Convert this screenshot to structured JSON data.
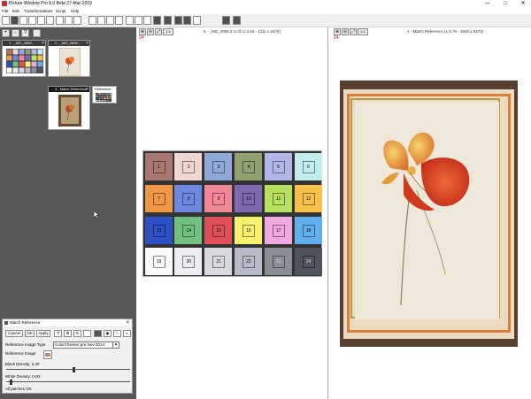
{
  "window": {
    "title": "Picture Window Pro 8.0 Beta 27-Mar-2019",
    "controls": [
      "—",
      "□",
      "✕"
    ]
  },
  "menu": [
    "File",
    "Edit",
    "Transformations",
    "Script",
    "Help"
  ],
  "left_pane": {
    "thumbnails": [
      {
        "label": "1 - _MG_4908...",
        "kind": "colorchecker"
      },
      {
        "label": "2 - _MG_4908...",
        "kind": "flower"
      },
      {
        "label": "3 - Match Reference",
        "kind": "flower-brown"
      }
    ],
    "reference_tag": "Reference"
  },
  "panel": {
    "title": "Match Reference",
    "buttons": {
      "cancel": "Cancel",
      "ok": "OK",
      "apply": "Apply"
    },
    "help": "?",
    "reference_image_type_label": "Reference Image Type",
    "reference_image_type_value": "ColorChecker pre Nov-2014",
    "reference_image_label": "Reference Image",
    "black_density_label": "Black Density: 2.30",
    "black_density_value": 0.55,
    "white_density_label": "White Density: 0.00",
    "white_density_value": 0.03,
    "status": "All patches OK"
  },
  "views": {
    "left": {
      "header": "5 - _MG_4908 8 cr.tif (1:3.93 - 2111 x 1679)",
      "zoom_badge": "24"
    },
    "right": {
      "header": "4 - Match Reference (1:9.79 - 3648 x 5472)",
      "zoom_badge": "24"
    },
    "zoom_tools": [
      "⊕",
      "⊖",
      "⤢",
      "1:1"
    ]
  },
  "colors": {
    "left_pane_bg": "#575757",
    "accent_red": "#d00000",
    "frame_orange": "#d8803a"
  },
  "colorchecker": [
    {
      "label": "1",
      "color": "#a87870"
    },
    {
      "label": "2",
      "color": "#f0d8d0"
    },
    {
      "label": "3",
      "color": "#8ea8d8"
    },
    {
      "label": "4",
      "color": "#90a070"
    },
    {
      "label": "5",
      "color": "#b0b8e8"
    },
    {
      "label": "6",
      "color": "#c0ecec"
    },
    {
      "label": "7",
      "color": "#f09848"
    },
    {
      "label": "8",
      "color": "#6c88e0"
    },
    {
      "label": "9",
      "color": "#f08898"
    },
    {
      "label": "10",
      "color": "#8068b0"
    },
    {
      "label": "11",
      "color": "#b8e060"
    },
    {
      "label": "12",
      "color": "#f8c048"
    },
    {
      "label": "13",
      "color": "#3050c8"
    },
    {
      "label": "14",
      "color": "#70c080"
    },
    {
      "label": "15",
      "color": "#e05058"
    },
    {
      "label": "16",
      "color": "#f8f070"
    },
    {
      "label": "17",
      "color": "#f0a8e0"
    },
    {
      "label": "18",
      "color": "#60b0f0"
    },
    {
      "label": "19",
      "color": "#fafafa"
    },
    {
      "label": "20",
      "color": "#eeeef2"
    },
    {
      "label": "21",
      "color": "#d8dae0"
    },
    {
      "label": "22",
      "color": "#b8bcc8"
    },
    {
      "label": "23",
      "color": "#8a8e98"
    },
    {
      "label": "24",
      "color": "#50545e"
    }
  ]
}
